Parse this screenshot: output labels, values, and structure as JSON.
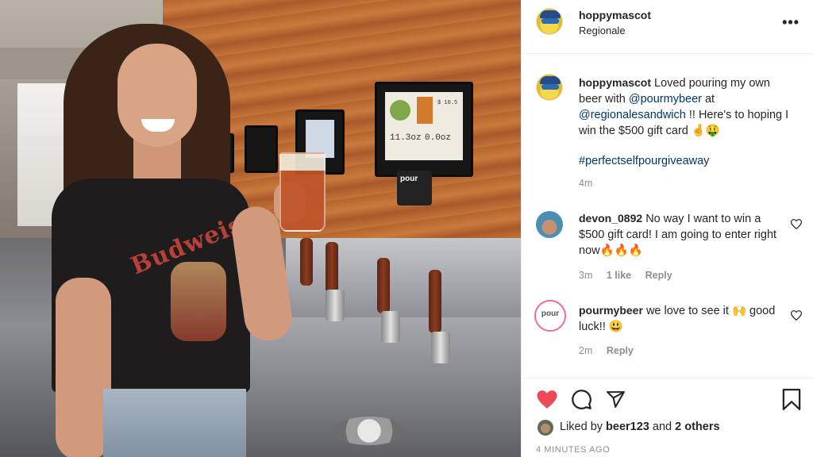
{
  "post": {
    "author": "hoppymascot",
    "location": "Regionale",
    "more_label": "•••"
  },
  "photo": {
    "shirt_text": "Budweiser",
    "screen_left_value": "11.3oz",
    "screen_right_value": "0.0oz",
    "screen_price": "$ 10.5",
    "tap_brand": "pour"
  },
  "caption": {
    "username": "hoppymascot",
    "text_1": " Loved pouring my own beer with ",
    "mention_1": "@pourmybeer",
    "text_2": " at ",
    "mention_2": "@regionalesandwich",
    "text_3": " !! Here's to hoping I win the $500 gift card 🤞🤑",
    "hashtag": "#perfectselfpourgiveaway",
    "time": "4m"
  },
  "comments": [
    {
      "username": "devon_0892",
      "text": " No way I want to win a $500 gift card! I am going to enter right now🔥🔥🔥",
      "time": "3m",
      "likes": "1 like",
      "reply": "Reply"
    },
    {
      "username": "pourmybeer",
      "text": " we love to see it 🙌 good luck!! 😃",
      "time": "2m",
      "reply": "Reply",
      "avatar_label": "pour"
    }
  ],
  "likes": {
    "prefix": "Liked by ",
    "user": "beer123",
    "middle": " and ",
    "others": "2 others"
  },
  "timestamp": "4 MINUTES AGO",
  "colors": {
    "like_red": "#ed4956",
    "link_blue": "#00376b",
    "muted_gray": "#8e8e8e"
  },
  "icons": [
    "heart-filled-icon",
    "comment-icon",
    "share-icon",
    "bookmark-icon",
    "more-icon",
    "heart-outline-icon"
  ]
}
